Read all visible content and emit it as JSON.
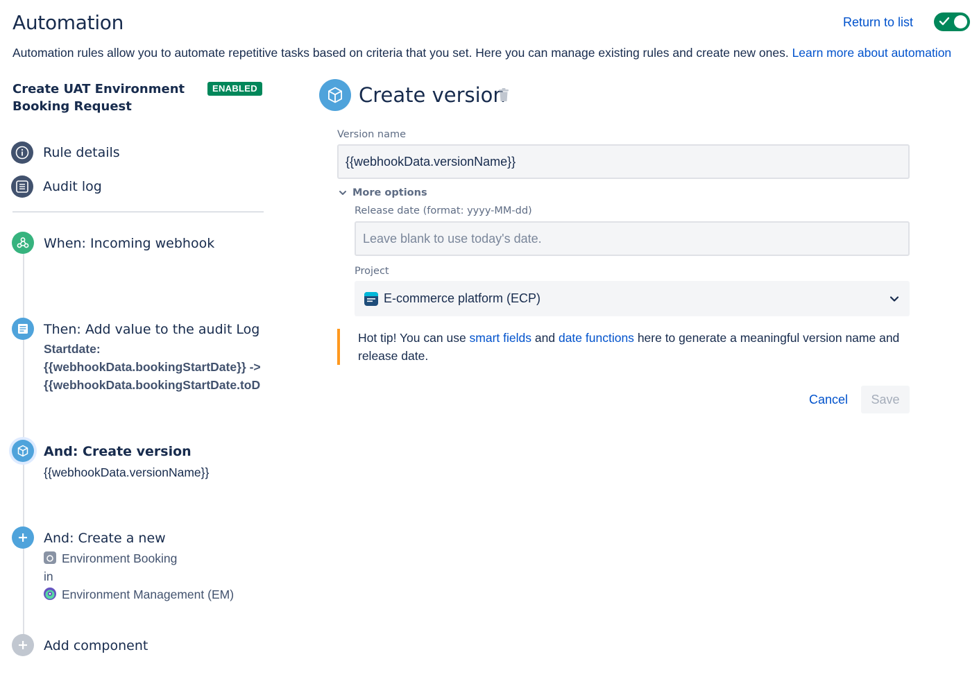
{
  "header": {
    "title": "Automation",
    "return_link": "Return to list",
    "rule_enabled": true,
    "intro_text": "Automation rules allow you to automate repetitive tasks based on criteria that you set. Here you can manage existing rules and create new ones.",
    "learn_more": "Learn more about automation"
  },
  "rule": {
    "name": "Create UAT Environment Booking Request",
    "status": "ENABLED"
  },
  "nav": [
    {
      "label": "Rule details",
      "icon": "info-icon"
    },
    {
      "label": "Audit log",
      "icon": "list-icon"
    }
  ],
  "steps": {
    "trigger": {
      "title": "When: Incoming webhook",
      "icon": "webhook-icon"
    },
    "audit": {
      "title": "Then: Add value to the audit Log",
      "lines": [
        "Startdate:",
        "{{webhookData.bookingStartDate}} ->",
        "{{webhookData.bookingStartDate.toD"
      ],
      "icon": "audit-log-icon"
    },
    "create_version": {
      "title": "And: Create version",
      "body": "{{webhookData.versionName}}",
      "icon": "cube-icon"
    },
    "create_new": {
      "title": "And: Create a new",
      "issue_type": "Environment Booking",
      "in": "in",
      "project": "Environment Management (EM)",
      "icon": "plus-icon"
    },
    "add_component": {
      "title": "Add component",
      "icon": "plus-icon"
    }
  },
  "form": {
    "title": "Create version",
    "version_name_label": "Version name",
    "version_name_value": "{{webhookData.versionName}}",
    "more_options": "More options",
    "release_date_label": "Release date (format: yyyy-MM-dd)",
    "release_date_placeholder": "Leave blank to use today's date.",
    "project_label": "Project",
    "project_value": "E-commerce platform (ECP)",
    "tip_prefix": "Hot tip! You can use",
    "tip_link1": "smart fields",
    "tip_and": "and",
    "tip_link2": "date functions",
    "tip_suffix": "here to generate a meaningful version name and release date.",
    "cancel": "Cancel",
    "save": "Save"
  },
  "colors": {
    "link": "#0052cc",
    "enabled_green": "#00875a",
    "webhook_green": "#36b37e",
    "step_blue": "#4fa3db",
    "tip_orange": "#ff991f"
  }
}
